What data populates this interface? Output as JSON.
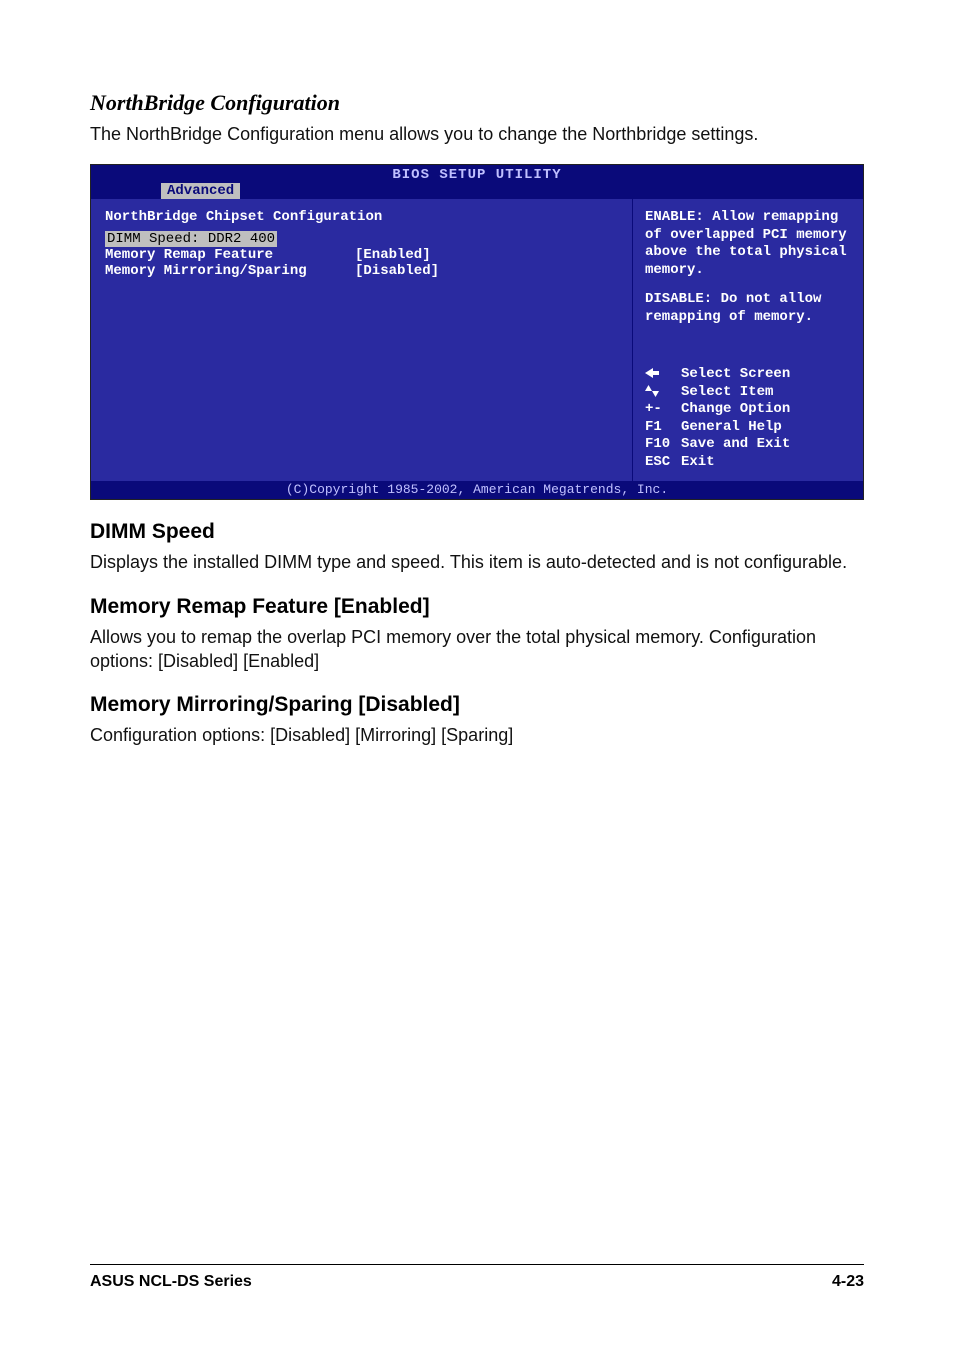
{
  "sections": {
    "northbridge": {
      "heading": "NorthBridge Configuration",
      "body": "The NorthBridge Configuration menu allows you to change the Northbridge settings."
    },
    "dimm_speed": {
      "heading": "DIMM Speed",
      "body": "Displays the installed DIMM type and speed. This item is auto-detected and is not configurable."
    },
    "mem_remap": {
      "heading": "Memory Remap Feature [Enabled]",
      "body": "Allows you to remap the overlap PCI memory over the total physical memory. Configuration options: [Disabled] [Enabled]"
    },
    "mem_mirror": {
      "heading": "Memory Mirroring/Sparing [Disabled]",
      "body": "Configuration options: [Disabled] [Mirroring] [Sparing]"
    }
  },
  "bios": {
    "title": "BIOS SETUP UTILITY",
    "tab": "Advanced",
    "section_title": "NorthBridge Chipset Configuration",
    "rows": {
      "dimm_speed": {
        "label": "DIMM Speed: DDR2 400"
      },
      "remap": {
        "label": "Memory Remap Feature",
        "value": "[Enabled]"
      },
      "mirror": {
        "label": "Memory Mirroring/Sparing",
        "value": "[Disabled]"
      }
    },
    "help1": "ENABLE: Allow remapping of overlapped PCI memory above the total physical memory.",
    "help2": "DISABLE: Do not allow remapping of memory.",
    "nav": {
      "screen": "Select Screen",
      "item": "Select Item",
      "change_key": "+-",
      "change": "Change Option",
      "help_key": "F1",
      "help": "General Help",
      "save_key": "F10",
      "save": "Save and Exit",
      "exit_key": "ESC",
      "exit": "Exit"
    },
    "footer": "(C)Copyright 1985-2002, American Megatrends, Inc."
  },
  "page_footer": {
    "left": "ASUS NCL-DS Series",
    "right": "4-23"
  }
}
